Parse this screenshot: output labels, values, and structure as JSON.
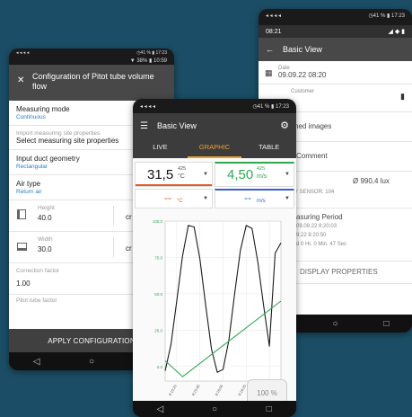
{
  "colors": {
    "background": "#1b4e66",
    "temp": "#e05a2b",
    "velocity": "#2fa84f",
    "blue": "#3a5fd1",
    "tab_active": "#f0a030",
    "link": "#2b7fc1"
  },
  "phone_a": {
    "status_left": "◂ ◂ ◂ ◂",
    "status_right": "◷41 % ▮ 17:23",
    "topbar_time": "08:21",
    "topbar_icons": "◢ ◆ ▮",
    "title": "Basic View",
    "date_label": "Date",
    "date_value": "09.09.22 08:20",
    "customer_label": "Customer",
    "images_label": "ched images",
    "comment_label": "Comment",
    "reading_prefix": "e",
    "reading_value": "Ø 990,4 lux",
    "sensor_text": "BY SENSOR: 104",
    "period_label": "asuring Period",
    "period_start": "09.09.22 8:20:03",
    "period_end": "9.22 8:20:50",
    "period_duration": "d 0 Hr. 0 Min. 47 Sec",
    "display_props": "DISPLAY PROPERTIES",
    "nav": [
      "◁",
      "○",
      "□"
    ]
  },
  "phone_b": {
    "status_left": "◂ ◂ ◂ ◂",
    "status_right": "◷41 % ▮ 17:23",
    "status_right2": "▼ 38% ▮ 10:59",
    "title": "Configuration of Pitot tube volume flow",
    "measuring_mode_label": "Measuring mode",
    "measuring_mode_value": "Continuous",
    "import_label": "Import measuring site properties",
    "import_value": "Select measuring site properties",
    "duct_label": "Input duct geometry",
    "duct_value": "Rectangular",
    "air_label": "Air type",
    "air_value": "Return air",
    "height_label": "Height",
    "height_value": "40.0",
    "height_unit": "cr",
    "width_label": "Width",
    "width_value": "30.0",
    "width_unit": "cr",
    "correction_label": "Correction factor",
    "correction_value": "1.00",
    "pitot_label": "Pitot tube factor",
    "apply_label": "APPLY CONFIGURATION",
    "nav": [
      "◁",
      "○",
      "□"
    ]
  },
  "phone_c": {
    "status_left": "◂ ◂ ◂ ◂",
    "status_right": "◷41 % ▮ 17:23",
    "title": "Basic View",
    "tabs": [
      "LIVE",
      "GRAPHIC",
      "TABLE"
    ],
    "tile1": {
      "value": "31,5",
      "probe": "425",
      "unit": "°C"
    },
    "tile2": {
      "value": "4,50",
      "probe": "425",
      "unit": "m/s"
    },
    "tile3": {
      "value": "--",
      "unit": "°C"
    },
    "tile4": {
      "value": "--",
      "unit": "m/s"
    },
    "zoom": "100 %",
    "nav": [
      "◁",
      "○",
      "□"
    ]
  },
  "chart_data": {
    "type": "line",
    "y_ticks": [
      "100.0",
      "75.0",
      "50.0",
      "25.0",
      "0.0"
    ],
    "x_ticks": [
      "8:15:25",
      "8:15:45",
      "8:16:05",
      "8:16:25",
      "8:16:45"
    ],
    "ylim": [
      -10,
      100
    ],
    "series": [
      {
        "color": "#1a1a1a",
        "x": [
          0,
          0.5,
          1,
          1.5,
          2,
          2.5,
          3,
          3.5,
          4,
          4.5,
          5,
          5.5,
          6,
          6.5,
          7,
          7.5,
          8,
          8.5,
          9,
          9.5,
          10
        ],
        "values": [
          -3,
          15,
          45,
          76,
          97,
          96,
          74,
          42,
          12,
          -4,
          -2,
          18,
          50,
          80,
          97,
          95,
          72,
          42,
          14,
          78,
          85
        ]
      },
      {
        "color": "#2fa84f",
        "x": [
          0,
          1.5,
          10
        ],
        "values": [
          4,
          -7,
          45
        ]
      }
    ]
  }
}
